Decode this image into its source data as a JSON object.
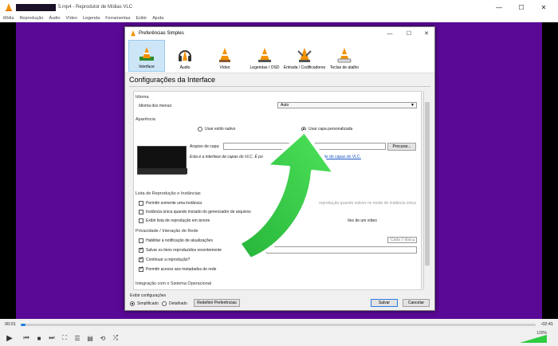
{
  "app": {
    "title": "5.mp4 - Reprodutor de Mídias VLC",
    "window_controls": [
      "—",
      "☐",
      "✕"
    ]
  },
  "menu": [
    "Mídia",
    "Reprodução",
    "Áudio",
    "Vídeo",
    "Legenda",
    "Ferramentas",
    "Exibir",
    "Ajuda"
  ],
  "player": {
    "time_elapsed": "00:01",
    "time_total": "-02:41",
    "progress": 0.006,
    "volume": "120%"
  },
  "dialog": {
    "title": "Preferências Simples",
    "categories": [
      {
        "label": "Interface",
        "icon": "interface-cone-icon",
        "selected": true
      },
      {
        "label": "Áudio",
        "icon": "audio-headphones-icon",
        "selected": false
      },
      {
        "label": "Vídeo",
        "icon": "video-cone-icon",
        "selected": false
      },
      {
        "label": "Legendas / OSD",
        "icon": "subtitles-cone-icon",
        "selected": false
      },
      {
        "label": "Entrada / Codificadores",
        "icon": "input-codecs-icon",
        "selected": false
      },
      {
        "label": "Teclas de atalho",
        "icon": "hotkeys-cone-icon",
        "selected": false
      }
    ],
    "heading": "Configurações da Interface",
    "sections": {
      "idioma": {
        "title": "Idioma",
        "label": "Idioma dos menus:",
        "value": "Auto"
      },
      "aparencia": {
        "title": "Aparência",
        "native": "Usar estilo nativo",
        "custom": "Usar capa personalizada",
        "skin_file_label": "Arquivo de capa:",
        "browse": "Procurar...",
        "skin_note": "Esta é a interface de capas do VLC. É po",
        "skin_link": "site de capas do VLC."
      },
      "lista": {
        "title": "Lista de Reprodução e Instâncias",
        "items": [
          {
            "label": "Permitir somente uma instância",
            "checked": false
          },
          {
            "label": "Instância única quando iniciado do gerenciador de arquivos",
            "checked": false
          },
          {
            "label": "Exibir lista de reprodução em árvore",
            "checked": false
          }
        ],
        "enqueue_note": "reprodução quando estiver no modo de instância única",
        "video_note": "ões de um vídeo"
      },
      "privacidade": {
        "title": "Privacidade / Interação de Rede",
        "items": [
          {
            "label": "Habilitar a notificação de atualizações",
            "checked": false
          },
          {
            "label": "Salvar os itens reproduzidos recentemente",
            "checked": true
          },
          {
            "label": "Continuar a reprodução?",
            "checked": true
          },
          {
            "label": "Permitir acesso aos metadados de rede",
            "checked": true
          }
        ],
        "update_interval": "Cada 7 dias",
        "filter_label": "Filtro:"
      },
      "integracao": {
        "title": "Integração com o Sistema Operacional"
      }
    },
    "footer": {
      "show_label": "Exibir configurações",
      "simple": "Simplificado",
      "detailed": "Detalhado",
      "reset": "Redefinir Preferências",
      "save": "Salvar",
      "cancel": "Cancelar"
    }
  },
  "colors": {
    "video_bg": "#5a0996",
    "accent": "#1f7de0",
    "arrow": "#2ecc40"
  }
}
